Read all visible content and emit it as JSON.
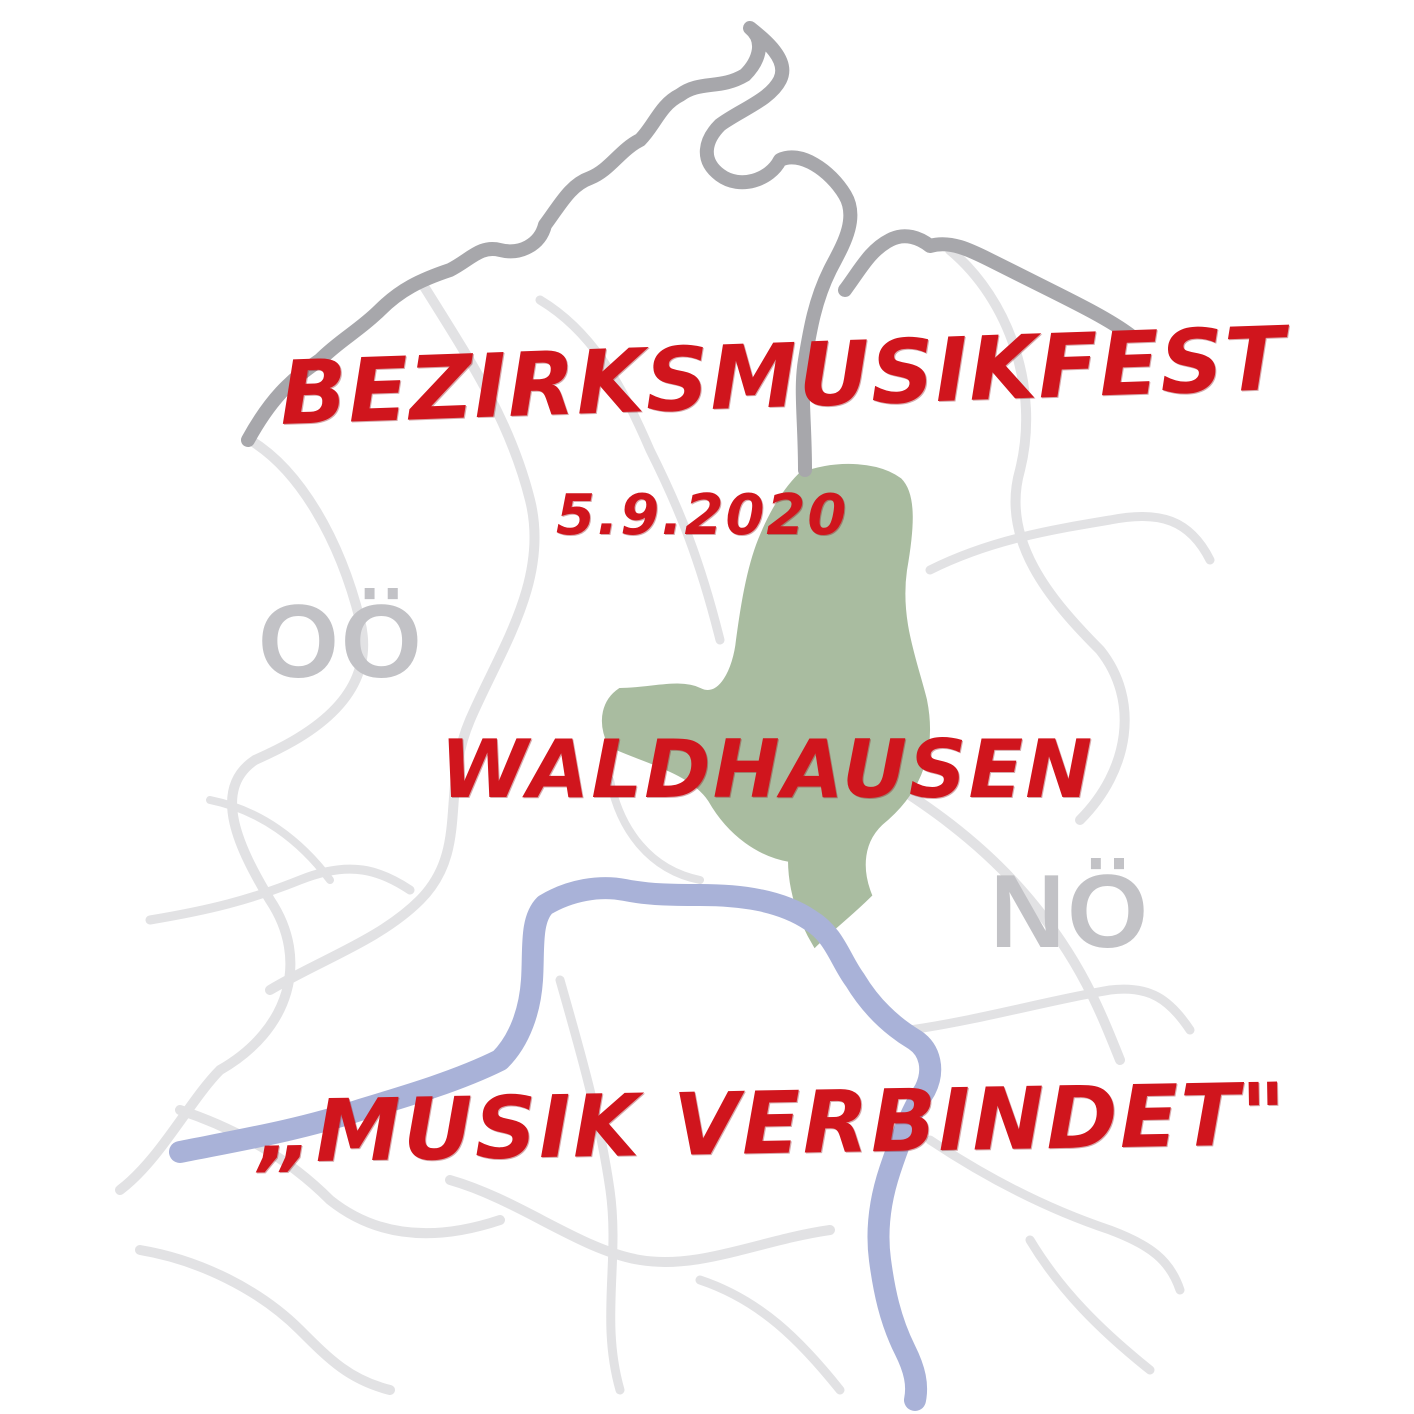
{
  "poster": {
    "title": "Bezirksmusikfest",
    "date": "5.9.2020",
    "place": "Waldhausen",
    "motto": "„Musik verbindet\""
  },
  "map": {
    "labels": {
      "upper_austria": "OÖ",
      "lower_austria": "NÖ"
    },
    "features": {
      "highlighted_area": "Waldhausen",
      "river": "blue river line",
      "border": "dark grey state border line"
    }
  },
  "colors": {
    "headline": "#d0151d",
    "label": "#c2c2c6",
    "highlight": "#a9bca0",
    "river": "#a9b2d8",
    "border": "#a7a7ab",
    "district_lines": "#e2e2e4",
    "background": "#ffffff"
  }
}
